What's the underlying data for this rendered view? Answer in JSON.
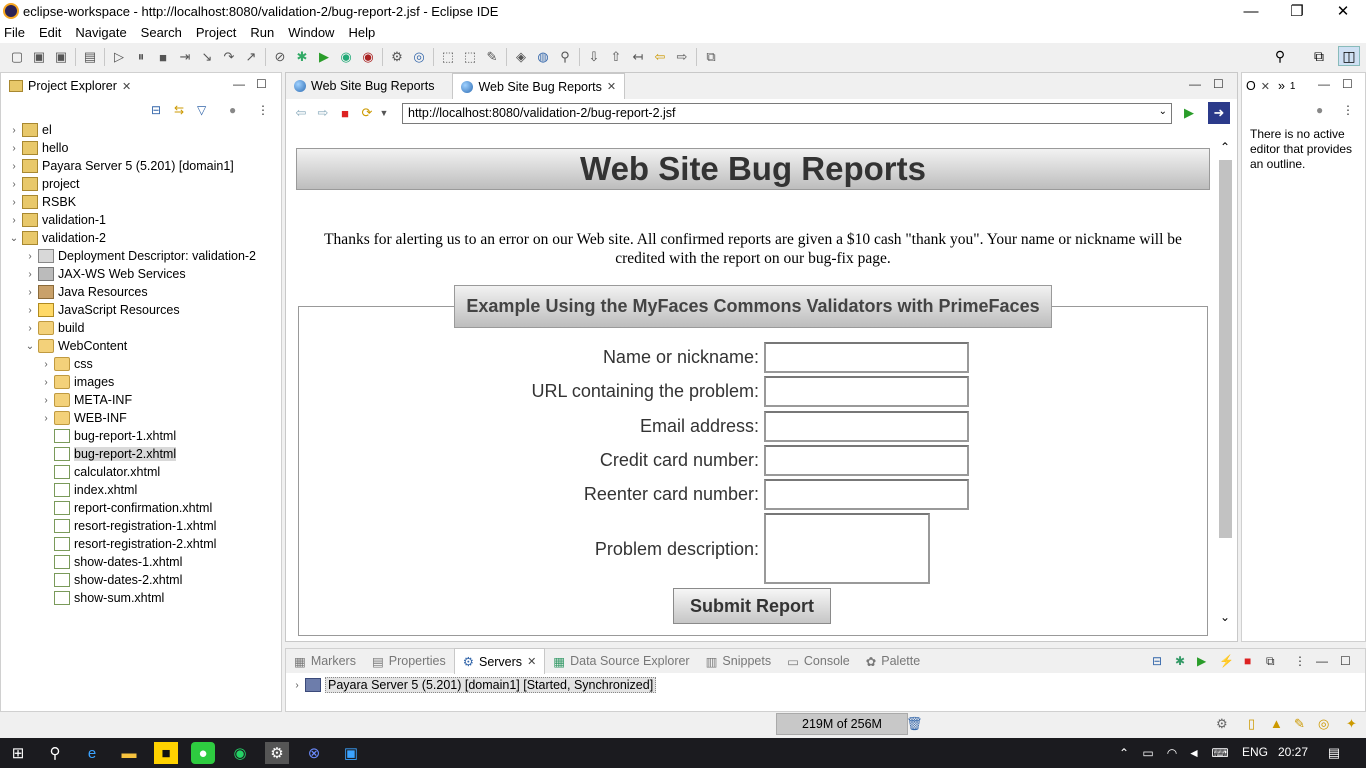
{
  "window": {
    "title": "eclipse-workspace - http://localhost:8080/validation-2/bug-report-2.jsf - Eclipse IDE",
    "minimize": "—",
    "restore": "❐",
    "close": "✕"
  },
  "menu": [
    "File",
    "Edit",
    "Navigate",
    "Search",
    "Project",
    "Run",
    "Window",
    "Help"
  ],
  "project_explorer": {
    "title": "Project Explorer",
    "items": [
      {
        "label": "el",
        "type": "proj"
      },
      {
        "label": "hello",
        "type": "proj"
      },
      {
        "label": "Payara Server 5 (5.201) [domain1]",
        "type": "proj"
      },
      {
        "label": "project",
        "type": "proj"
      },
      {
        "label": "RSBK",
        "type": "proj"
      },
      {
        "label": "validation-1",
        "type": "proj"
      },
      {
        "label": "validation-2",
        "type": "proj"
      },
      {
        "label": "Deployment Descriptor: validation-2",
        "type": "dd"
      },
      {
        "label": "JAX-WS Web Services",
        "type": "ws"
      },
      {
        "label": "Java Resources",
        "type": "lib"
      },
      {
        "label": "JavaScript Resources",
        "type": "js"
      },
      {
        "label": "build",
        "type": "folder"
      },
      {
        "label": "WebContent",
        "type": "folder"
      },
      {
        "label": "css",
        "type": "folder"
      },
      {
        "label": "images",
        "type": "folder"
      },
      {
        "label": "META-INF",
        "type": "folder"
      },
      {
        "label": "WEB-INF",
        "type": "folder"
      },
      {
        "label": "bug-report-1.xhtml",
        "type": "file"
      },
      {
        "label": "bug-report-2.xhtml",
        "type": "file"
      },
      {
        "label": "calculator.xhtml",
        "type": "file"
      },
      {
        "label": "index.xhtml",
        "type": "file"
      },
      {
        "label": "report-confirmation.xhtml",
        "type": "file"
      },
      {
        "label": "resort-registration-1.xhtml",
        "type": "file"
      },
      {
        "label": "resort-registration-2.xhtml",
        "type": "file"
      },
      {
        "label": "show-dates-1.xhtml",
        "type": "file"
      },
      {
        "label": "show-dates-2.xhtml",
        "type": "file"
      },
      {
        "label": "show-sum.xhtml",
        "type": "file"
      }
    ]
  },
  "editor": {
    "tabs": [
      "Web Site Bug Reports",
      "Web Site Bug Reports"
    ],
    "url": "http://localhost:8080/validation-2/bug-report-2.jsf"
  },
  "page": {
    "title": "Web Site Bug Reports",
    "intro": "Thanks for alerting us to an error on our Web site. All confirmed reports are given a $10 cash \"thank you\". Your name or nickname will be credited with the report on our bug-fix page.",
    "legend": "Example Using the MyFaces Commons Validators with PrimeFaces",
    "labels": {
      "name": "Name or nickname:",
      "url": "URL containing the problem:",
      "email": "Email address:",
      "card": "Credit card number:",
      "card2": "Reenter card number:",
      "desc": "Problem description:"
    },
    "submit": "Submit Report"
  },
  "outline": {
    "tab1": "O",
    "tab2": "1",
    "message": "There is no active editor that provides an outline."
  },
  "bottom": {
    "tabs": [
      "Markers",
      "Properties",
      "Servers",
      "Data Source Explorer",
      "Snippets",
      "Console",
      "Palette"
    ],
    "server_row": "Payara Server 5 (5.201) [domain1]  [Started, Synchronized]"
  },
  "status": {
    "heap": "219M of 256M"
  },
  "taskbar": {
    "lang": "ENG",
    "time": "20:27"
  }
}
